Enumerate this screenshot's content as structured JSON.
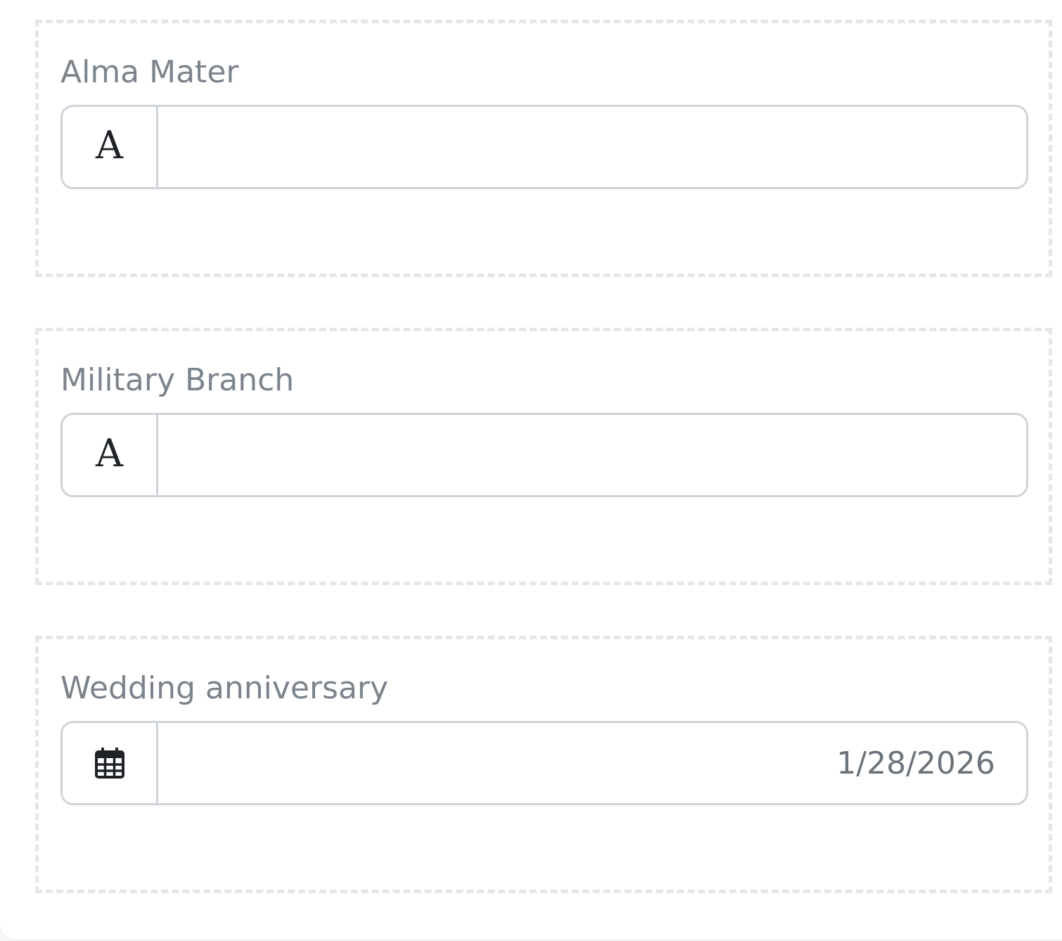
{
  "fields": [
    {
      "label": "Alma Mater",
      "icon": "text-icon",
      "value": ""
    },
    {
      "label": "Military Branch",
      "icon": "text-icon",
      "value": ""
    },
    {
      "label": "Wedding anniversary",
      "icon": "calendar-icon",
      "value": "1/28/2026"
    }
  ],
  "icons": {
    "text_glyph": "A"
  },
  "colors": {
    "label": "#7c838b",
    "border": "#cfd4da",
    "dashed": "#e4e6e9"
  }
}
